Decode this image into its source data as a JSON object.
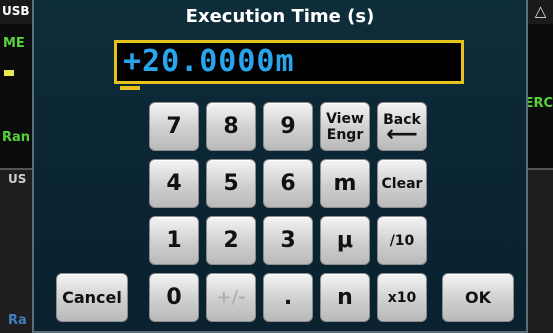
{
  "background": {
    "left_tab_label": "USB",
    "left_meas_label": "ME",
    "left_range_label": "Ran",
    "left_panel_label": "US",
    "left_bottom_label": "Ra",
    "right_icon_glyph": "△",
    "right_label": "ERC"
  },
  "dialog": {
    "title": "Execution Time (s)",
    "entry_value": "+20.0000m"
  },
  "keys": {
    "k7": "7",
    "k8": "8",
    "k9": "9",
    "view_engr_line1": "View",
    "view_engr_line2": "Engr",
    "back_label": "Back",
    "back_arrow": "⟵",
    "k4": "4",
    "k5": "5",
    "k6": "6",
    "milli": "m",
    "clear": "Clear",
    "k1": "1",
    "k2": "2",
    "k3": "3",
    "micro": "μ",
    "div10": "/10",
    "cancel": "Cancel",
    "k0": "0",
    "plus_minus": "+/-",
    "dot": ".",
    "nano": "n",
    "x10": "x10",
    "ok": "OK"
  },
  "colors": {
    "entry_text": "#29a5ee",
    "entry_border": "#e6c21c",
    "dialog_bg": "#0a2432"
  }
}
